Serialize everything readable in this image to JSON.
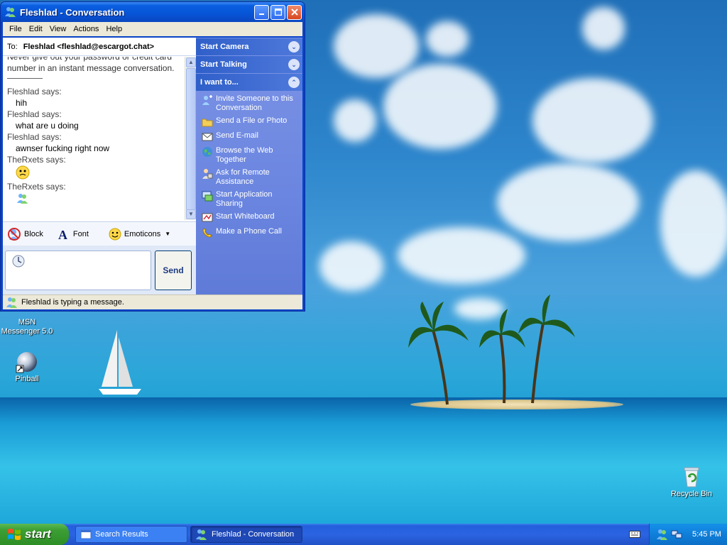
{
  "window": {
    "title": "Fleshlad - Conversation",
    "menu": [
      "File",
      "Edit",
      "View",
      "Actions",
      "Help"
    ],
    "to_label": "To:",
    "to_value": "Fleshlad <fleshlad@escargot.chat>",
    "history": {
      "warning": "Never give out your password or credit card number in an instant message conversation.",
      "messages": [
        {
          "sender": "Fleshlad says:",
          "text": "hih"
        },
        {
          "sender": "Fleshlad says:",
          "text": "what are u doing"
        },
        {
          "sender": "Fleshlad says:",
          "text": "awnser fucking right now"
        },
        {
          "sender": "TheRxets says:",
          "emoticon": "confused-smiley"
        },
        {
          "sender": "TheRxets says:",
          "emoticon": "msn-buddy"
        }
      ]
    },
    "toolbar": {
      "block_label": "Block",
      "font_label": "Font",
      "emoticons_label": "Emoticons"
    },
    "send_label": "Send",
    "status": "Fleshlad is typing a message.",
    "sidebar": {
      "start_camera": "Start Camera",
      "start_talking": "Start Talking",
      "i_want_to": "I want to...",
      "actions": [
        "Invite Someone to this Conversation",
        "Send a File or Photo",
        "Send E-mail",
        "Browse the Web Together",
        "Ask for Remote Assistance",
        "Start Application Sharing",
        "Start Whiteboard",
        "Make a Phone Call"
      ]
    }
  },
  "desktop": {
    "icons": [
      {
        "label": "MSN Messenger 5.0"
      },
      {
        "label": "Pinball"
      },
      {
        "label": "Recycle Bin"
      }
    ]
  },
  "taskbar": {
    "start_label": "start",
    "tasks": [
      "Search Results",
      "Fleshlad - Conversation"
    ],
    "clock": "5:45 PM"
  },
  "colors": {
    "title_blue": "#0a5ee0",
    "sidebar_blue": "#6b86e0",
    "start_green": "#3c9e33",
    "taskbar_blue": "#245edc"
  }
}
